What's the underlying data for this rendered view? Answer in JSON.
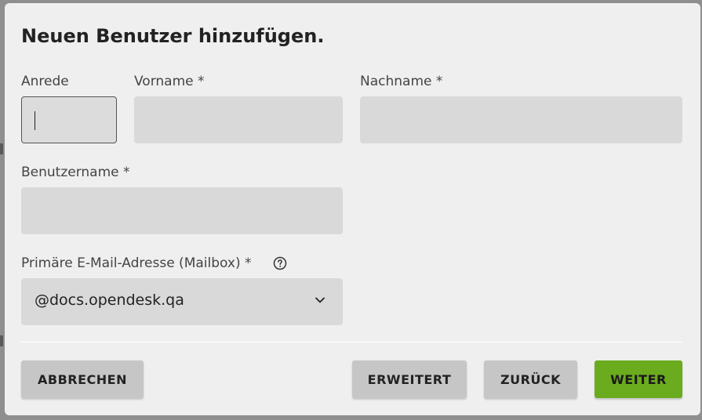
{
  "dialog": {
    "title": "Neuen Benutzer hinzufügen."
  },
  "form": {
    "salutation": {
      "label": "Anrede",
      "value": ""
    },
    "firstname": {
      "label": "Vorname *",
      "value": ""
    },
    "lastname": {
      "label": "Nachname *",
      "value": ""
    },
    "username": {
      "label": "Benutzername *",
      "value": ""
    },
    "mailbox": {
      "label": "Primäre E-Mail-Adresse (Mailbox) *",
      "selected": "@docs.opendesk.qa"
    }
  },
  "icons": {
    "help": "help-circle-icon",
    "dropdown": "chevron-down-icon"
  },
  "actions": {
    "cancel": "ABBRECHEN",
    "advanced": "ERWEITERT",
    "back": "ZURÜCK",
    "next": "WEITER"
  },
  "colors": {
    "primary": "#6bab1e",
    "button": "#c6c6c6",
    "field": "#d9d9d9",
    "dialog": "#efefef"
  }
}
